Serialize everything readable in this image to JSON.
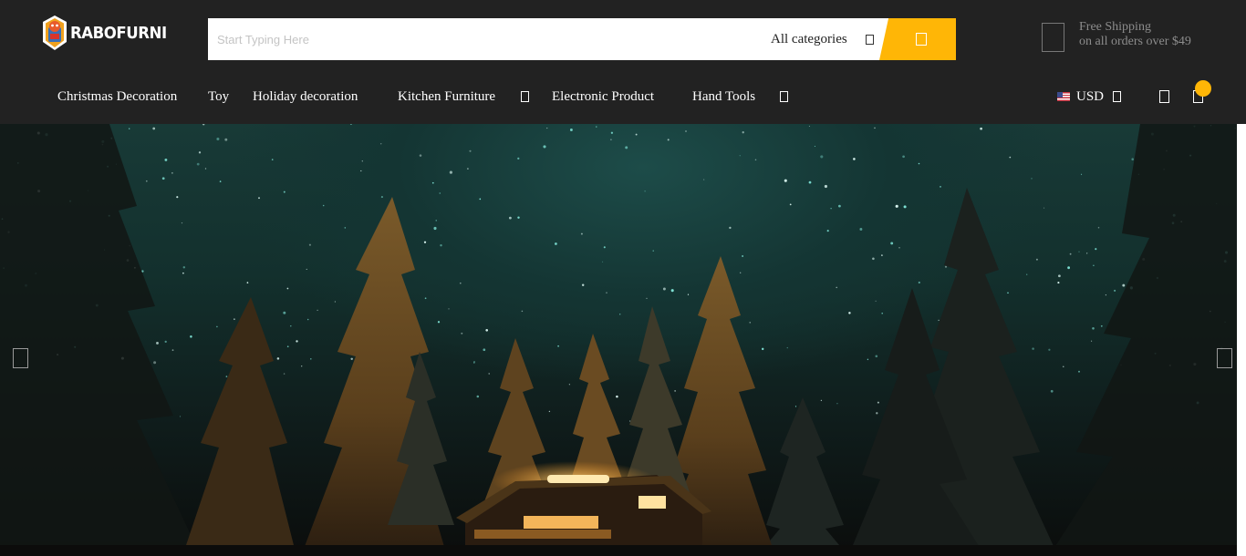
{
  "brand": {
    "name": "RABOFURNI",
    "logo_icon": "mascot-badge-icon"
  },
  "search": {
    "placeholder": "Start Typing Here",
    "value": "",
    "category_label": "All categories",
    "chevron_icon": "chevron-down-icon",
    "button_icon": "search-icon",
    "button_color": "#ffb606"
  },
  "shipping": {
    "icon": "truck-icon",
    "line1": "Free Shipping",
    "line2": "on all orders over $49"
  },
  "nav": {
    "items": [
      {
        "label": "Christmas Decoration",
        "has_dropdown": false
      },
      {
        "label": "Toy",
        "has_dropdown": false
      },
      {
        "label": "Holiday decoration",
        "has_dropdown": false
      },
      {
        "label": "Kitchen Furniture",
        "has_dropdown": true
      },
      {
        "label": "Electronic Product",
        "has_dropdown": false
      },
      {
        "label": "Hand Tools",
        "has_dropdown": true
      }
    ]
  },
  "header_actions": {
    "currency": "USD",
    "currency_flag_icon": "us-flag-icon",
    "account_icon": "user-icon",
    "cart_icon": "cart-icon",
    "cart_badge_color": "#ffb606"
  },
  "hero": {
    "image": "night-sky-forest-cabin",
    "prev_icon": "arrow-left-icon",
    "next_icon": "arrow-right-icon"
  },
  "colors": {
    "header_bg": "#222222",
    "accent": "#ffb606",
    "muted_text": "#8c8c8c"
  }
}
